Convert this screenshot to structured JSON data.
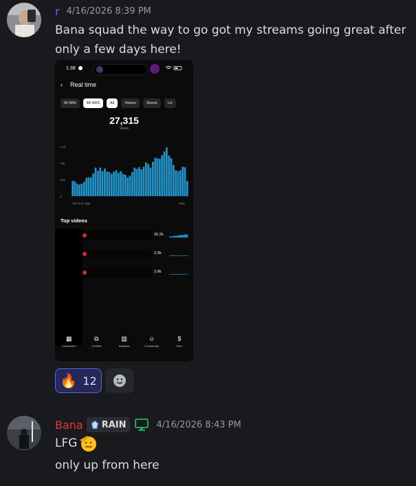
{
  "msg1": {
    "username": "r",
    "timestamp": "4/16/2026 8:39 PM",
    "text_line1": "Bana squad the way to go got my streams going great after",
    "text_line2": "only a few days here!",
    "colors": {
      "username": "#5865f2"
    },
    "screenshot": {
      "status_time": "1:38",
      "back_title": "Real time",
      "chips": [
        "60 MIN",
        "48 HRS",
        "All",
        "Videos",
        "Shorts",
        "Liv"
      ],
      "views_value": "27,315",
      "views_label": "Views",
      "y_ticks": [
        "1.1k",
        "740",
        "370",
        "0"
      ],
      "x_start": "48 hours ago",
      "x_end": "Now",
      "top_videos_title": "Top videos",
      "top_videos": [
        {
          "value": "20.2k"
        },
        {
          "value": "3.3k"
        },
        {
          "value": "2.8k"
        }
      ],
      "tabs": [
        {
          "label": "Dashboard",
          "icon": "dashboard-icon"
        },
        {
          "label": "Content",
          "icon": "content-icon"
        },
        {
          "label": "Analytics",
          "icon": "analytics-icon"
        },
        {
          "label": "Community",
          "icon": "community-icon"
        },
        {
          "label": "Earn",
          "icon": "earn-icon"
        }
      ],
      "chart_data": {
        "type": "bar",
        "title": "",
        "xlabel": "",
        "ylabel": "Views",
        "ylim": [
          0,
          1110
        ],
        "x_range_labels": [
          "48 hours ago",
          "Now"
        ],
        "values": [
          340,
          330,
          280,
          260,
          280,
          320,
          410,
          420,
          420,
          510,
          640,
          570,
          640,
          560,
          620,
          550,
          540,
          500,
          550,
          580,
          520,
          560,
          500,
          480,
          420,
          460,
          540,
          640,
          610,
          650,
          600,
          660,
          760,
          720,
          640,
          770,
          860,
          850,
          840,
          920,
          1000,
          1090,
          910,
          850,
          700,
          580,
          560,
          580,
          660,
          650,
          340
        ]
      }
    },
    "reaction": {
      "emoji": "🔥",
      "count": "12"
    }
  },
  "msg2": {
    "username": "Bana",
    "badge": "RAIN",
    "timestamp": "4/16/2026 8:43 PM",
    "line1": "LFG",
    "line2": "only up from here",
    "colors": {
      "username": "#d83c3e",
      "monitor": "#23a55a"
    }
  }
}
